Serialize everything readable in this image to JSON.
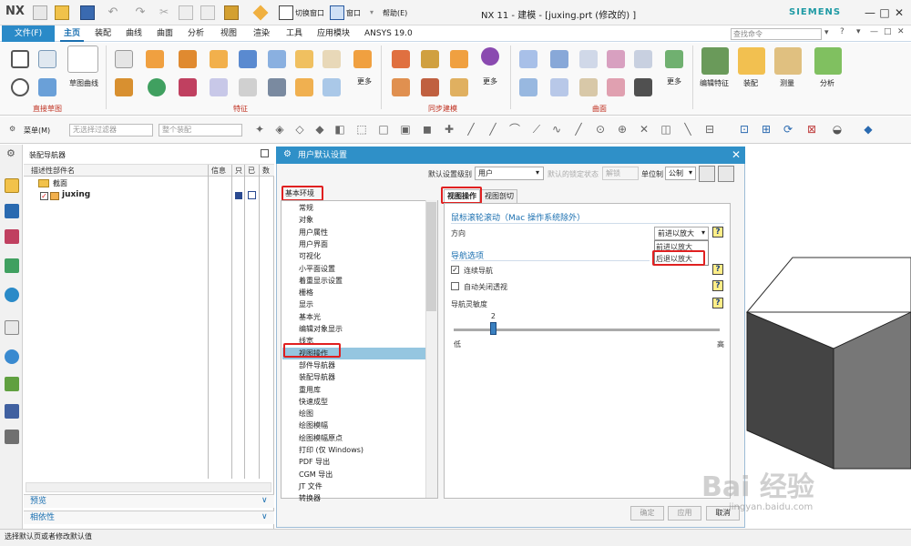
{
  "titlebar": {
    "logo": "NX",
    "switch_window": "切换窗口",
    "window_menu": "窗口",
    "help_menu": "帮助(E)",
    "title": "NX 11 - 建模 - [juxing.prt  (修改的) ]",
    "brand": "SIEMENS",
    "win_min": "—",
    "win_max": "□",
    "win_close": "✕"
  },
  "menu": {
    "file": "文件(F)",
    "tabs": [
      "主页",
      "装配",
      "曲线",
      "曲面",
      "分析",
      "视图",
      "渲染",
      "工具",
      "应用模块",
      "ANSYS 19.0"
    ],
    "active_index": 0,
    "search_placeholder": "查找命令"
  },
  "ribbon": {
    "groups": [
      "直接草图",
      "特征",
      "同步建模",
      "曲面"
    ],
    "sketch_curve": "草图曲线",
    "more": "更多",
    "edit_feature": "编辑特征",
    "assembly": "装配",
    "measure": "测量",
    "analysis": "分析"
  },
  "toolbar2": {
    "menu_button": "菜单(M)",
    "filter_placeholder": "无选择过滤器",
    "assembly_placeholder": "整个装配"
  },
  "navigator": {
    "title": "装配导航器",
    "columns": [
      "描述性部件名",
      "信息",
      "只",
      "已",
      "数"
    ],
    "rows": [
      {
        "name": "截面",
        "level": 1
      },
      {
        "name": "juxing",
        "level": 1
      }
    ],
    "accordion": [
      "预览",
      "相依性"
    ]
  },
  "dialog": {
    "title": "用户默认设置",
    "level_label": "默认设置级别",
    "level_value": "用户",
    "lock_label": "默认的锁定状态",
    "lock_value": "解锁",
    "unit_label": "单位制",
    "unit_value": "公制",
    "tree_root": "基本环境",
    "tree_items": [
      "常规",
      "对象",
      "用户属性",
      "用户界面",
      "可视化",
      "小平面设置",
      "着重显示设置",
      "栅格",
      "显示",
      "基本光",
      "编辑对象显示",
      "线宽",
      "视图操作",
      "部件导航器",
      "装配导航器",
      "重用库",
      "快速成型",
      "绘图",
      "绘图模幅",
      "绘图模幅原点",
      "打印 (仅 Windows)",
      "PDF 导出",
      "CGM 导出",
      "JT 文件",
      "转换器"
    ],
    "tree_selected_index": 12,
    "tabs": [
      "视图操作",
      "视图剖切"
    ],
    "active_tab": 0,
    "mouse_section": "鼠标滚轮滚动（Mac 操作系统除外）",
    "direction_label": "方向",
    "direction_value": "前进以放大",
    "direction_options": [
      "前进以放大",
      "后退以放大"
    ],
    "nav_section": "导航选项",
    "continuous_nav": "连续导航",
    "continuous_checked": true,
    "auto_persp": "自动关闭透视",
    "auto_persp_checked": false,
    "sensitivity_label": "导航灵敏度",
    "sensitivity_value": "2",
    "sensitivity_fraction": 0.14,
    "low_label": "低",
    "high_label": "高",
    "ok": "确定",
    "apply": "应用",
    "cancel": "取消",
    "help_glyph": "?"
  },
  "status": {
    "text": "选择默认页或者修改默认值"
  },
  "watermark": {
    "text": "Bai 经验",
    "url": "jingyan.baidu.com"
  },
  "colors": {
    "accent": "#2a8ac8",
    "highlight_red": "#e02020",
    "selection": "#95c6e0"
  }
}
